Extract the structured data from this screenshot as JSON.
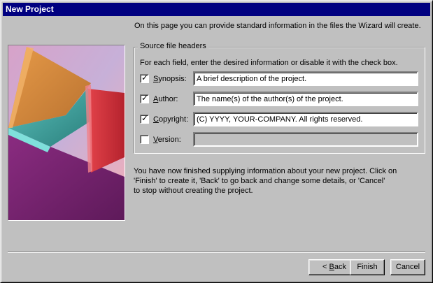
{
  "window": {
    "title": "New Project"
  },
  "intro_text": "On this page you can provide standard information in the files the Wizard will create.",
  "source_headers": {
    "legend": "Source file headers",
    "instructions": "For each field, enter the desired information or disable it with the check box.",
    "fields": [
      {
        "label_pre": "",
        "label_u": "S",
        "label_post": "ynopsis:",
        "checked": true,
        "value": "A brief description of the project.",
        "enabled": true
      },
      {
        "label_pre": "",
        "label_u": "A",
        "label_post": "uthor:",
        "checked": true,
        "value": "The name(s) of the author(s) of the project.",
        "enabled": true
      },
      {
        "label_pre": "",
        "label_u": "C",
        "label_post": "opyright:",
        "checked": true,
        "value": "(C) YYYY, YOUR-COMPANY.  All rights reserved.",
        "enabled": true
      },
      {
        "label_pre": "",
        "label_u": "V",
        "label_post": "ersion:",
        "checked": false,
        "value": "",
        "enabled": false
      }
    ]
  },
  "finish_text": {
    "line1": "You have now finished supplying information about your new project.  Click on",
    "line2": "'Finish' to create it, 'Back' to go back and change some details, or 'Cancel'",
    "line3": "to stop without creating the project."
  },
  "buttons": {
    "back_pre": "< ",
    "back_u": "B",
    "back_post": "ack",
    "finish": "Finish",
    "cancel": "Cancel"
  },
  "colors": {
    "titlebar": "#000080",
    "dialog": "#c0c0c0",
    "art_orange": "#d98a3a",
    "art_teal": "#3fa7a3",
    "art_red": "#d2313b",
    "art_purple": "#7b2673"
  }
}
